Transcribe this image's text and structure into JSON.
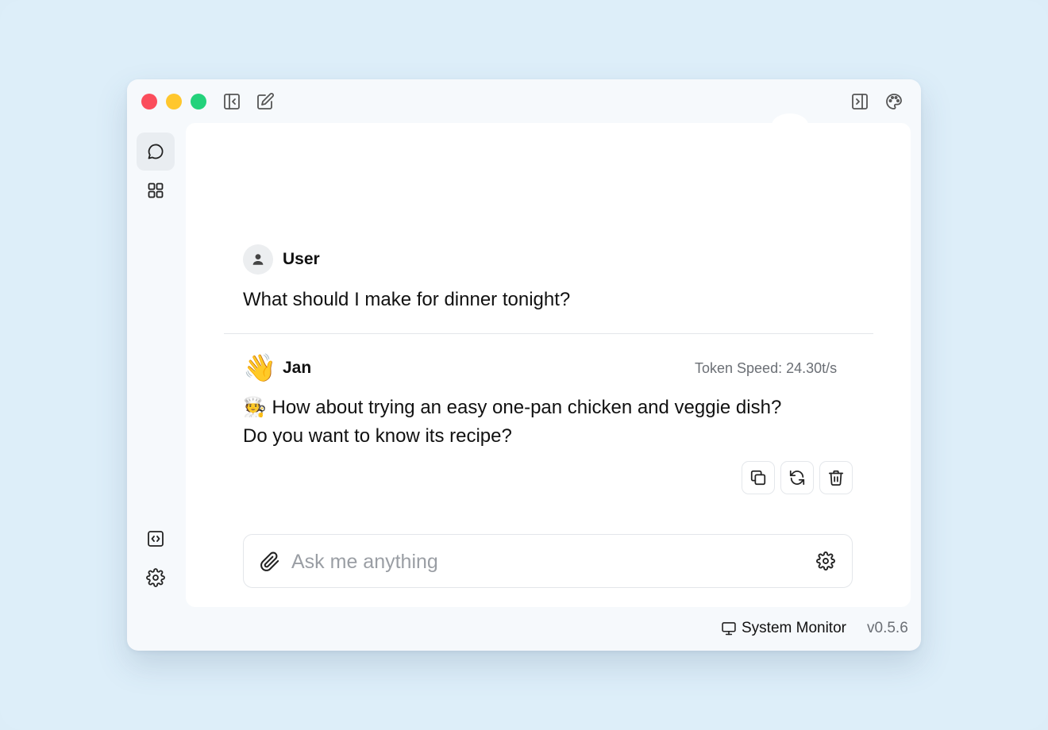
{
  "toolbar": {
    "icons": [
      "collapse-sidebar-icon",
      "new-chat-icon",
      "right-panel-icon",
      "palette-icon"
    ]
  },
  "sidebar": {
    "items": [
      {
        "icon": "chat-bubble-icon",
        "active": true
      },
      {
        "icon": "grid-icon",
        "active": false
      }
    ],
    "bottom_items": [
      {
        "icon": "code-icon"
      },
      {
        "icon": "gear-icon"
      }
    ]
  },
  "conversation": {
    "user": {
      "name": "User",
      "text": "What should I make for dinner tonight?"
    },
    "assistant": {
      "name": "Jan",
      "avatar": "👋",
      "token_speed": "Token Speed: 24.30t/s",
      "line1": "🧑‍🍳 How about trying an easy one-pan chicken and veggie dish?",
      "line2": "Do you want to know its recipe?",
      "actions": [
        "copy-icon",
        "regenerate-icon",
        "trash-icon"
      ]
    }
  },
  "composer": {
    "placeholder": "Ask me anything",
    "value": ""
  },
  "status": {
    "system_monitor": "System Monitor",
    "version": "v0.5.6"
  },
  "colors": {
    "background": "#ddeef9",
    "window": "#f6f9fc",
    "traffic_red": "#fb4d5c",
    "traffic_yellow": "#ffc72d",
    "traffic_green": "#23d27b"
  }
}
